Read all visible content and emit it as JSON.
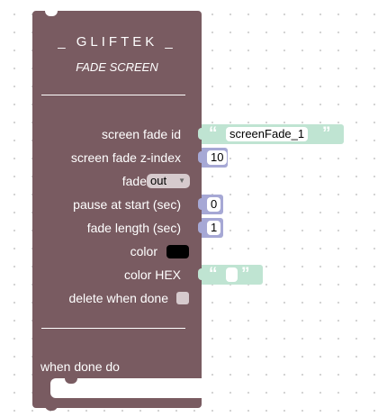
{
  "block": {
    "title": "_ GLIFTEK _",
    "subtitle": "FADE SCREEN",
    "fields": {
      "screen_fade_id_label": "screen fade id",
      "screen_fade_z_index_label": "screen fade z-index",
      "fade_label": "fade",
      "fade_value": "out",
      "pause_label": "pause at start (sec)",
      "fade_length_label": "fade length (sec)",
      "color_label": "color",
      "color_hex_label": "color HEX",
      "delete_label": "delete when done",
      "when_done_label": "when done do"
    }
  },
  "inputs": {
    "screen_fade_id": "screenFade_1",
    "z_index": "10",
    "pause": "0",
    "fade_length": "1",
    "color_hex": ""
  },
  "colors": {
    "block": "#795b61",
    "text_input": "#bfe4d2",
    "number_input": "#a6a8d5",
    "swatch": "#000000"
  }
}
